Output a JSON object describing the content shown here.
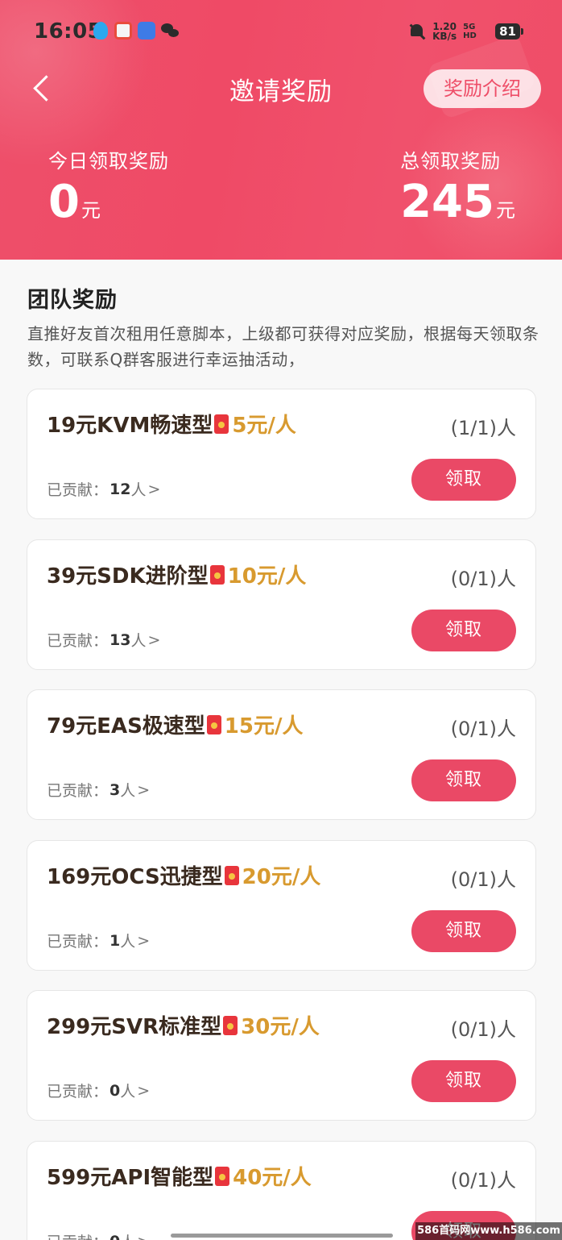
{
  "status_bar": {
    "time": "16:05",
    "net_speed_value": "1.20",
    "net_speed_unit": "KB/s",
    "signal_label": "5G HD",
    "battery": "81"
  },
  "nav": {
    "title": "邀请奖励",
    "intro_button": "奖励介绍"
  },
  "summary": {
    "today_label": "今日领取奖励",
    "today_value": "0",
    "today_unit": "元",
    "total_label": "总领取奖励",
    "total_value": "245",
    "total_unit": "元"
  },
  "section": {
    "title": "团队奖励",
    "description": "直推好友首次租用任意脚本，上级都可获得对应奖励，根据每天领取条数，可联系Q群客服进行幸运抽活动，"
  },
  "contrib_label": "已贡献：",
  "contrib_suffix": "人",
  "contrib_arrow": ">",
  "claim_label": "领取",
  "cards": [
    {
      "name": "19元KVM畅速型",
      "reward": "5元/人",
      "count": "(1/1)人",
      "contributed": "12"
    },
    {
      "name": "39元SDK进阶型",
      "reward": "10元/人",
      "count": "(0/1)人",
      "contributed": "13"
    },
    {
      "name": "79元EAS极速型",
      "reward": "15元/人",
      "count": "(0/1)人",
      "contributed": "3"
    },
    {
      "name": "169元OCS迅捷型",
      "reward": "20元/人",
      "count": "(0/1)人",
      "contributed": "1"
    },
    {
      "name": "299元SVR标准型",
      "reward": "30元/人",
      "count": "(0/1)人",
      "contributed": "0"
    },
    {
      "name": "599元API智能型",
      "reward": "40元/人",
      "count": "(0/1)人",
      "contributed": "0"
    }
  ],
  "watermark": "586首码网www.h586.com",
  "colors": {
    "brand": "#ee4f6a",
    "button": "#ea4966",
    "reward": "#d89a2f"
  },
  "icons": {
    "back": "chevron-left-icon",
    "reward": "red-envelope-icon"
  }
}
